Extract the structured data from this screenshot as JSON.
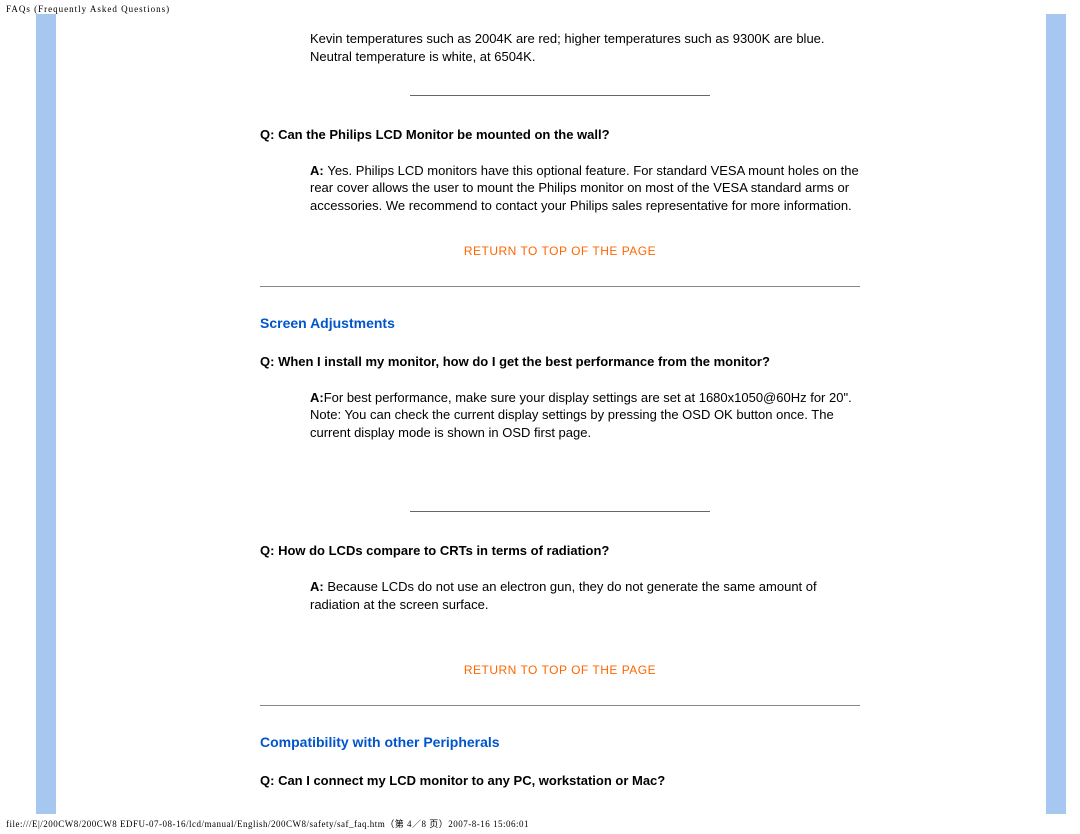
{
  "header": {
    "title": "FAQs (Frequently Asked Questions)"
  },
  "intro_para": "Kevin temperatures such as 2004K are red; higher temperatures such as 9300K are blue. Neutral temperature is white, at 6504K.",
  "faq1": {
    "q_prefix": "Q: ",
    "q_text": "Can the Philips LCD Monitor be mounted on the wall?",
    "a_prefix": "A: ",
    "a_text": "Yes. Philips LCD monitors have this optional feature. For standard VESA mount holes on the rear cover allows the user to mount the Philips monitor on most of the VESA standard arms or accessories. We recommend to contact your Philips sales representative for more information."
  },
  "return_link": "RETURN TO TOP OF THE PAGE",
  "section1": {
    "heading": "Screen Adjustments"
  },
  "faq2": {
    "q_prefix": "Q: ",
    "q_text": "When I install my monitor, how do I get the best performance from the monitor?",
    "a_prefix": "A:",
    "a_text": "For best performance, make sure your display settings are set at 1680x1050@60Hz for 20\". Note: You can check the current display settings by pressing the OSD OK button once. The current display mode is shown in OSD first page."
  },
  "faq3": {
    "q_prefix": "Q: ",
    "q_text": "How do LCDs compare to CRTs in terms of radiation?",
    "a_prefix": "A: ",
    "a_text": "Because LCDs do not use an electron gun, they do not generate the same amount of radiation at the screen surface."
  },
  "section2": {
    "heading": "Compatibility with other Peripherals"
  },
  "faq4": {
    "q_prefix": "Q: ",
    "q_text": "Can I connect my LCD monitor to any PC, workstation or Mac?"
  },
  "footer": {
    "path": "file:///E|/200CW8/200CW8 EDFU-07-08-16/lcd/manual/English/200CW8/safety/saf_faq.htm（第 4／8 页）2007-8-16 15:06:01"
  }
}
